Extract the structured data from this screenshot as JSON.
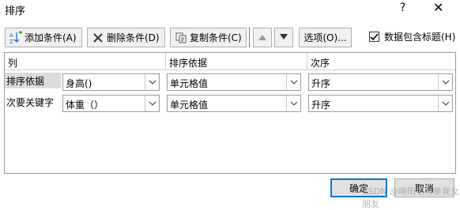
{
  "titlebar": {
    "title": "排序",
    "help": "?",
    "close": "✕"
  },
  "toolbar": {
    "add": "添加条件(A)",
    "delete": "删除条件(D)",
    "copy": "复制条件(C)",
    "options": "选项(O)...",
    "header_checkbox_label": "数据包含标题(H)",
    "header_checkbox_checked": true
  },
  "grid": {
    "headers": {
      "column": "列",
      "sort_on": "排序依据",
      "order": "次序"
    },
    "rows": [
      {
        "label": "排序依据",
        "column": "身高()",
        "sort_on": "单元格值",
        "order": "升序"
      },
      {
        "label": "次要关键字",
        "column": "体重（）",
        "sort_on": "单元格值",
        "order": "升序"
      }
    ]
  },
  "footer": {
    "ok": "确定",
    "cancel": "取消"
  },
  "watermark": "CSDN @晓阳老师是我女朋友"
}
